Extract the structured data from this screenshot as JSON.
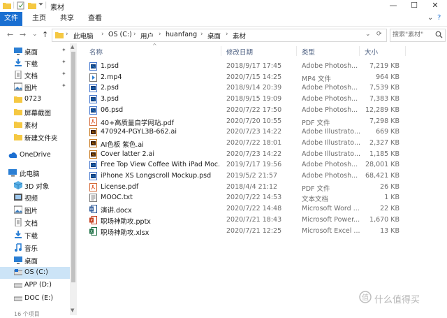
{
  "window": {
    "title": "素材",
    "min_label": "—",
    "max_label": "☐",
    "close_label": "✕"
  },
  "ribbon": {
    "tabs": [
      "文件",
      "主页",
      "共享",
      "查看"
    ],
    "expand_label": "⌄",
    "help_label": "?"
  },
  "address": {
    "back": "←",
    "forward": "→",
    "recent": "⌄",
    "up": "↑",
    "crumbs": [
      "此电脑",
      "OS (C:)",
      "用户",
      "huanfang",
      "桌面",
      "素材"
    ],
    "dropdown": "⌄",
    "refresh": "⟳",
    "search_placeholder": "搜索\"素材\""
  },
  "sidebar": {
    "items": [
      {
        "label": "桌面",
        "icon": "desktop-icon",
        "pinned": true
      },
      {
        "label": "下载",
        "icon": "download-icon",
        "pinned": true
      },
      {
        "label": "文档",
        "icon": "documents-icon",
        "pinned": true
      },
      {
        "label": "图片",
        "icon": "pictures-icon",
        "pinned": true
      },
      {
        "label": "0723",
        "icon": "folder-icon",
        "pinned": false
      },
      {
        "label": "屏幕截图",
        "icon": "folder-icon",
        "pinned": false
      },
      {
        "label": "素材",
        "icon": "folder-icon",
        "pinned": false
      },
      {
        "label": "新建文件夹",
        "icon": "folder-icon",
        "pinned": false
      },
      {
        "label": "OneDrive",
        "icon": "cloud-icon",
        "pinned": false
      },
      {
        "label": "此电脑",
        "icon": "computer-icon",
        "pinned": false
      },
      {
        "label": "3D 对象",
        "icon": "3d-objects-icon",
        "pinned": false
      },
      {
        "label": "视频",
        "icon": "videos-icon",
        "pinned": false
      },
      {
        "label": "图片",
        "icon": "pictures-icon",
        "pinned": false
      },
      {
        "label": "文档",
        "icon": "documents-icon",
        "pinned": false
      },
      {
        "label": "下载",
        "icon": "download-icon",
        "pinned": false
      },
      {
        "label": "音乐",
        "icon": "music-icon",
        "pinned": false
      },
      {
        "label": "桌面",
        "icon": "desktop-icon",
        "pinned": false
      },
      {
        "label": "OS (C:)",
        "icon": "drive-icon",
        "pinned": false
      },
      {
        "label": "APP (D:)",
        "icon": "drive-icon",
        "pinned": false
      },
      {
        "label": "DOC (E:)",
        "icon": "drive-icon",
        "pinned": false
      }
    ],
    "pin_glyph": "📌"
  },
  "columns": {
    "name": "名称",
    "date": "修改日期",
    "type": "类型",
    "size": "大小",
    "sort_glyph": "^"
  },
  "files": [
    {
      "name": "1.psd",
      "date": "2018/9/17 17:45",
      "type": "Adobe Photosh...",
      "size": "7,219 KB",
      "icon": "ps"
    },
    {
      "name": "2.mp4",
      "date": "2020/7/15 14:25",
      "type": "MP4 文件",
      "size": "964 KB",
      "icon": "mp4"
    },
    {
      "name": "2.psd",
      "date": "2018/9/14 20:39",
      "type": "Adobe Photosh...",
      "size": "7,539 KB",
      "icon": "ps"
    },
    {
      "name": "3.psd",
      "date": "2018/9/15 19:09",
      "type": "Adobe Photosh...",
      "size": "7,383 KB",
      "icon": "ps"
    },
    {
      "name": "06.psd",
      "date": "2020/7/22 17:50",
      "type": "Adobe Photosh...",
      "size": "12,289 KB",
      "icon": "ps"
    },
    {
      "name": "40+高质量自学网站.pdf",
      "date": "2020/7/20 10:55",
      "type": "PDF 文件",
      "size": "7,298 KB",
      "icon": "pdf"
    },
    {
      "name": "470924-PGYL3B-662.ai",
      "date": "2020/7/23 14:22",
      "type": "Adobe Illustrato...",
      "size": "669 KB",
      "icon": "ai"
    },
    {
      "name": "AI色板 紫色.ai",
      "date": "2020/7/22 18:01",
      "type": "Adobe Illustrato...",
      "size": "2,327 KB",
      "icon": "ai"
    },
    {
      "name": "Cover latter 2.ai",
      "date": "2020/7/23 14:22",
      "type": "Adobe Illustrato...",
      "size": "1,185 KB",
      "icon": "ai"
    },
    {
      "name": "Free Top View Coffee With iPad Moc...",
      "date": "2019/7/17 19:56",
      "type": "Adobe Photosh...",
      "size": "28,001 KB",
      "icon": "ps"
    },
    {
      "name": "iPhone XS Longscroll Mockup.psd",
      "date": "2019/5/2 21:57",
      "type": "Adobe Photosh...",
      "size": "68,421 KB",
      "icon": "ps"
    },
    {
      "name": "License.pdf",
      "date": "2018/4/4 21:12",
      "type": "PDF 文件",
      "size": "26 KB",
      "icon": "pdf"
    },
    {
      "name": "MOOC.txt",
      "date": "2020/7/22 14:53",
      "type": "文本文档",
      "size": "1 KB",
      "icon": "txt"
    },
    {
      "name": "演讲.docx",
      "date": "2020/7/22 14:48",
      "type": "Microsoft Word ...",
      "size": "22 KB",
      "icon": "docx"
    },
    {
      "name": "职场神助攻.pptx",
      "date": "2020/7/21 18:43",
      "type": "Microsoft Power...",
      "size": "1,670 KB",
      "icon": "pptx"
    },
    {
      "name": "职场神助攻.xlsx",
      "date": "2020/7/21 12:25",
      "type": "Microsoft Excel ...",
      "size": "13 KB",
      "icon": "xlsx"
    }
  ],
  "status": {
    "count": "16 个项目"
  },
  "watermark": {
    "text": "什么值得买"
  },
  "colors": {
    "accent": "#1a6fd1",
    "selected": "#cce4f7",
    "folder": "#f5c842"
  }
}
